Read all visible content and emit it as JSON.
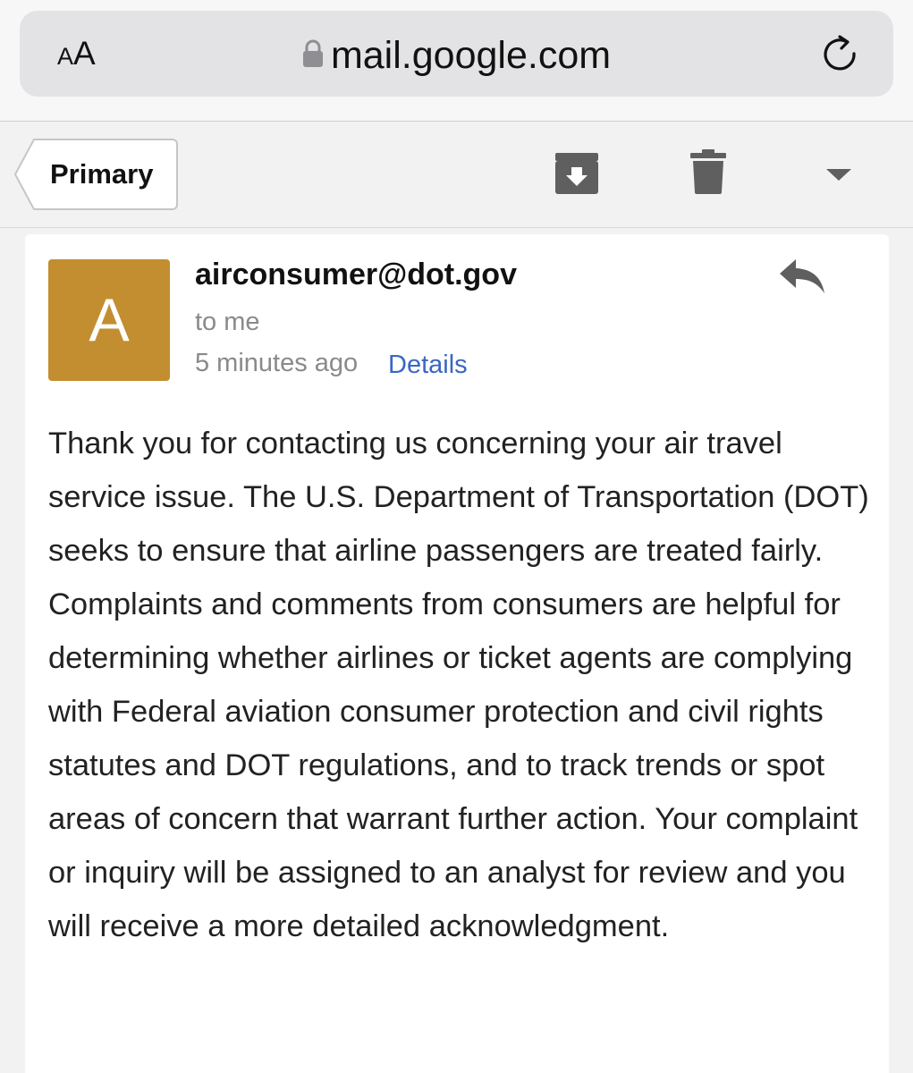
{
  "browser": {
    "text_size_label": "AA",
    "url": "mail.google.com",
    "icons": [
      "lock-icon",
      "reload-icon"
    ]
  },
  "toolbar": {
    "back_label": "Primary",
    "icons": [
      "archive-icon",
      "trash-icon",
      "more-dropdown-icon"
    ]
  },
  "message": {
    "avatar_letter": "A",
    "avatar_color": "#c28e30",
    "sender": "airconsumer@dot.gov",
    "recipient": "to me",
    "time": "5 minutes ago",
    "details_link": "Details",
    "body": "Thank you for contacting us concerning your air travel service issue. The U.S. Department of Transportation (DOT) seeks to ensure that airline passengers are treated fairly. Complaints and comments from consumers are helpful for determining whether airlines or ticket agents are complying with Federal aviation consumer protection and civil rights statutes and DOT regulations, and to track trends or spot areas of concern that warrant further action. Your complaint or inquiry will be assigned to an analyst for review and you will receive a more detailed acknowledgment."
  },
  "colors": {
    "link": "#3b66c4",
    "icon_gray": "#5f5f5f"
  }
}
